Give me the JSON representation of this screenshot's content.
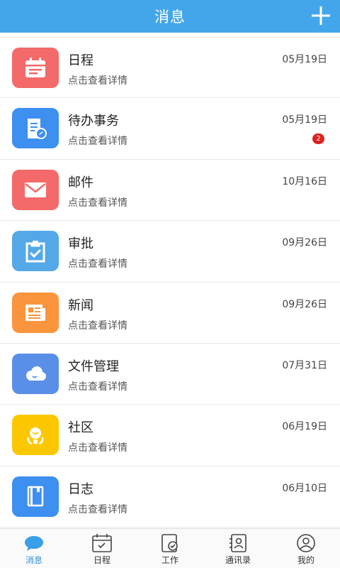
{
  "header": {
    "title": "消息"
  },
  "colors": {
    "header": "#44a6ea",
    "active_tab": "#2e8fdc",
    "badge": "#e02020"
  },
  "messages": [
    {
      "title": "日程",
      "subtitle": "点击查看详情",
      "date": "05月19日",
      "icon": "calendar-icon",
      "color": "#f46a6a"
    },
    {
      "title": "待办事务",
      "subtitle": "点击查看详情",
      "date": "05月19日",
      "icon": "todo-document-icon",
      "color": "#3d8ff0",
      "badge": "2"
    },
    {
      "title": "邮件",
      "subtitle": "点击查看详情",
      "date": "10月16日",
      "icon": "mail-icon",
      "color": "#f46a6a"
    },
    {
      "title": "审批",
      "subtitle": "点击查看详情",
      "date": "09月26日",
      "icon": "approval-clipboard-icon",
      "color": "#55a8e8"
    },
    {
      "title": "新闻",
      "subtitle": "点击查看详情",
      "date": "09月26日",
      "icon": "newspaper-icon",
      "color": "#fa943d"
    },
    {
      "title": "文件管理",
      "subtitle": "点击查看详情",
      "date": "07月31日",
      "icon": "cloud-icon",
      "color": "#5a8fe8"
    },
    {
      "title": "社区",
      "subtitle": "点击查看详情",
      "date": "06月19日",
      "icon": "community-person-icon",
      "color": "#fbc800"
    },
    {
      "title": "日志",
      "subtitle": "点击查看详情",
      "date": "06月10日",
      "icon": "notebook-icon",
      "color": "#3d8ff0"
    }
  ],
  "tabs": [
    {
      "label": "消息",
      "icon": "chat-bubble-icon",
      "active": true
    },
    {
      "label": "日程",
      "icon": "calendar-tab-icon"
    },
    {
      "label": "工作",
      "icon": "work-check-icon"
    },
    {
      "label": "通讯录",
      "icon": "contacts-icon"
    },
    {
      "label": "我的",
      "icon": "profile-icon"
    }
  ]
}
